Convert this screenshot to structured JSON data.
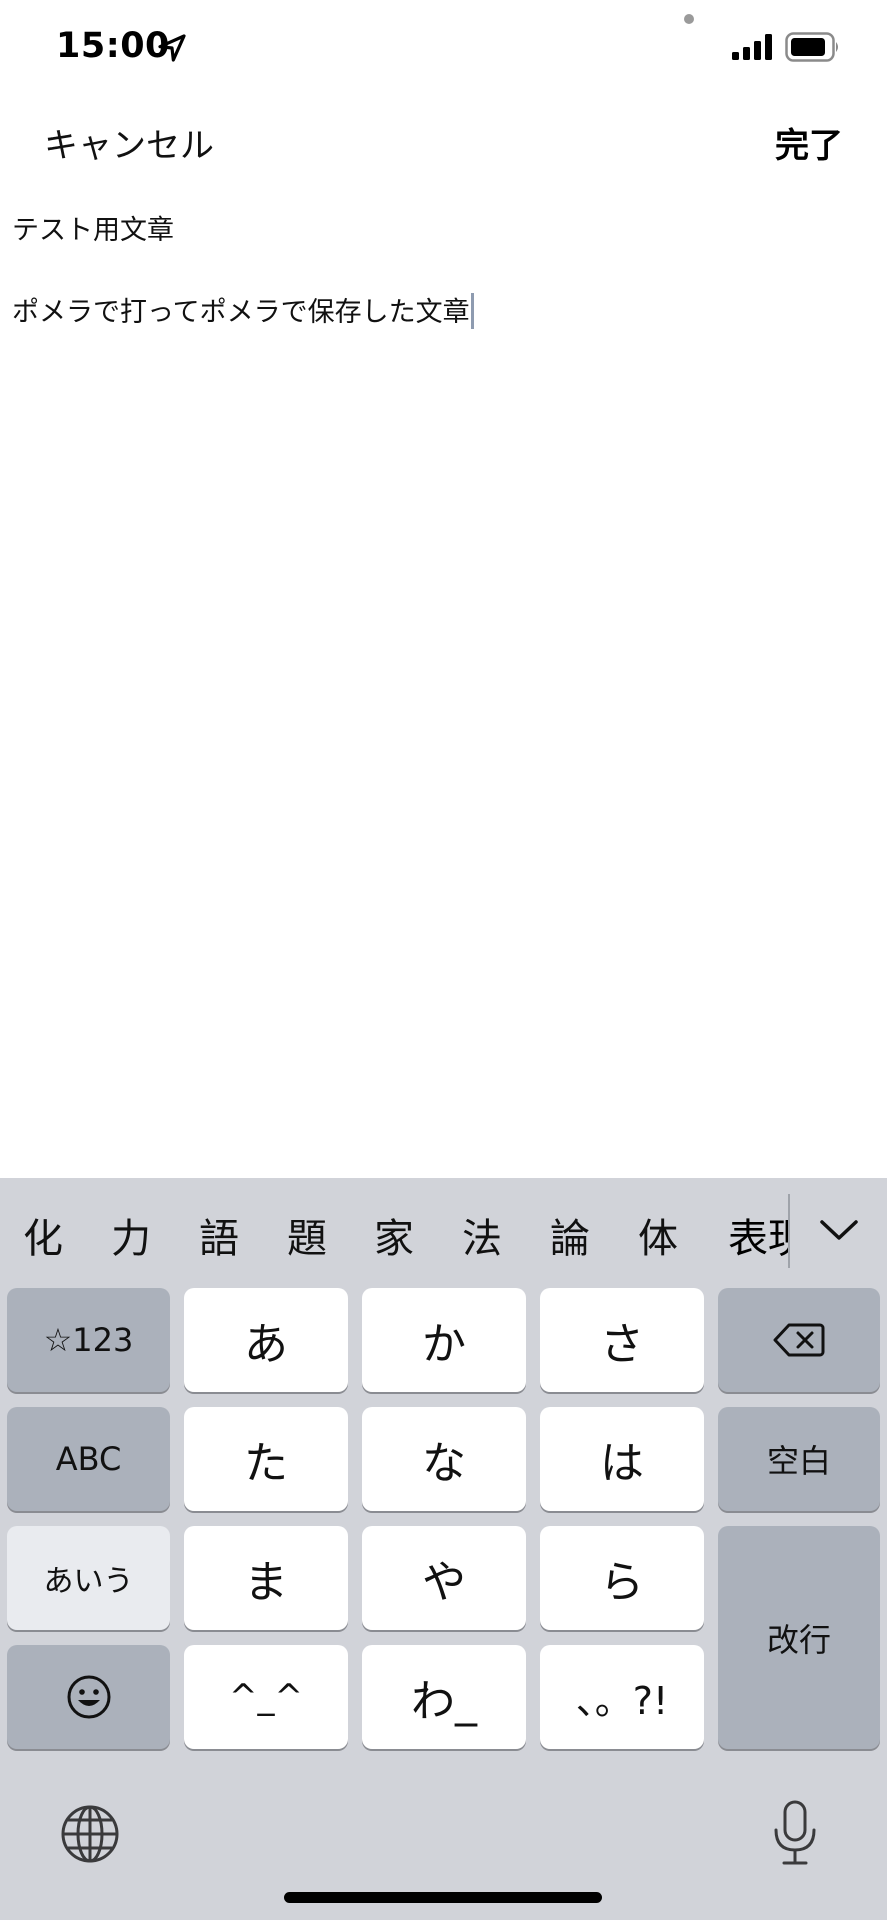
{
  "status_bar": {
    "time": "15:00",
    "icons": [
      "location-arrow-icon",
      "signal-bars-icon",
      "battery-icon"
    ]
  },
  "nav": {
    "cancel_label": "キャンセル",
    "done_label": "完了"
  },
  "content": {
    "line1": "テスト用文章",
    "line2": "ポメラで打ってポメラで保存した文章"
  },
  "keyboard": {
    "candidates": [
      "化",
      "力",
      "語",
      "題",
      "家",
      "法",
      "論",
      "体"
    ],
    "candidate_partial": "表現",
    "keys": {
      "sym": "☆123",
      "a": "あ",
      "ka": "か",
      "sa": "さ",
      "abc": "ABC",
      "ta": "た",
      "na": "な",
      "ha": "は",
      "space": "空白",
      "aiu": "あいう",
      "ma": "ま",
      "ya": "や",
      "ra": "ら",
      "return": "改行",
      "kaomoji": "^_^",
      "wa": "わ_",
      "punct": "、。?!"
    },
    "icons": [
      "backspace-icon",
      "emoji-icon",
      "globe-icon",
      "microphone-icon",
      "chevron-down-icon"
    ]
  },
  "colors": {
    "keyboard_bg": "#d1d3d9",
    "key_white": "#ffffff",
    "key_gray": "#abb1bb",
    "key_light": "#e9ebef"
  }
}
